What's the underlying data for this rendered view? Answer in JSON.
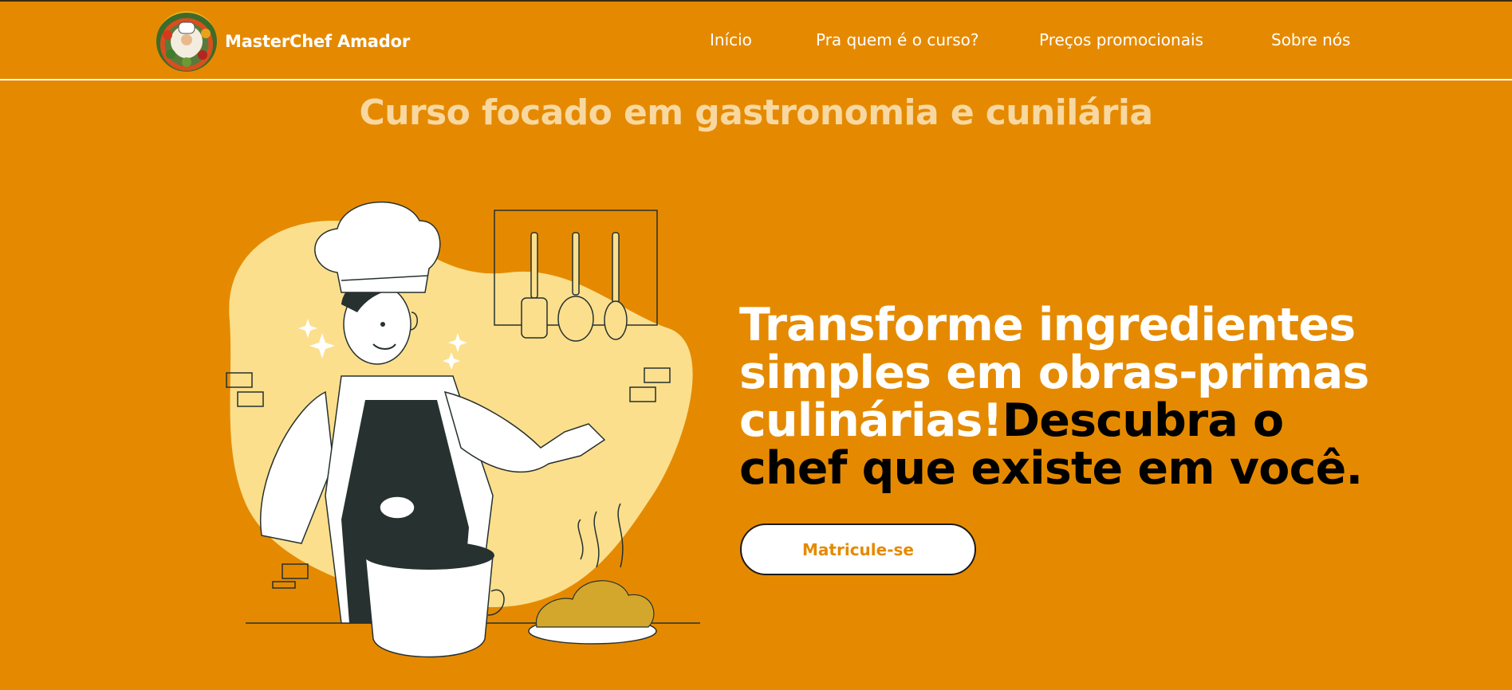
{
  "brand": {
    "name": "MasterChef Amador",
    "logo_icon": "chef-food-logo-icon"
  },
  "nav": {
    "items": [
      {
        "label": "Início"
      },
      {
        "label": "Pra quem é o curso?"
      },
      {
        "label": "Preços promocionais"
      },
      {
        "label": "Sobre nós"
      }
    ]
  },
  "hero": {
    "tagline": "Curso focado em gastronomia e cunilária",
    "headline_white": "Transforme ingredientes simples em obras-primas culinárias!",
    "headline_black": "Descubra o chef que existe em você.",
    "cta_label": "Matricule-se",
    "illustration_icon": "chef-cooking-illustration"
  },
  "colors": {
    "background": "#E58A00",
    "accent_light": "#FBDF8C",
    "tagline": "#F8D8A0",
    "dark": "#263130"
  }
}
